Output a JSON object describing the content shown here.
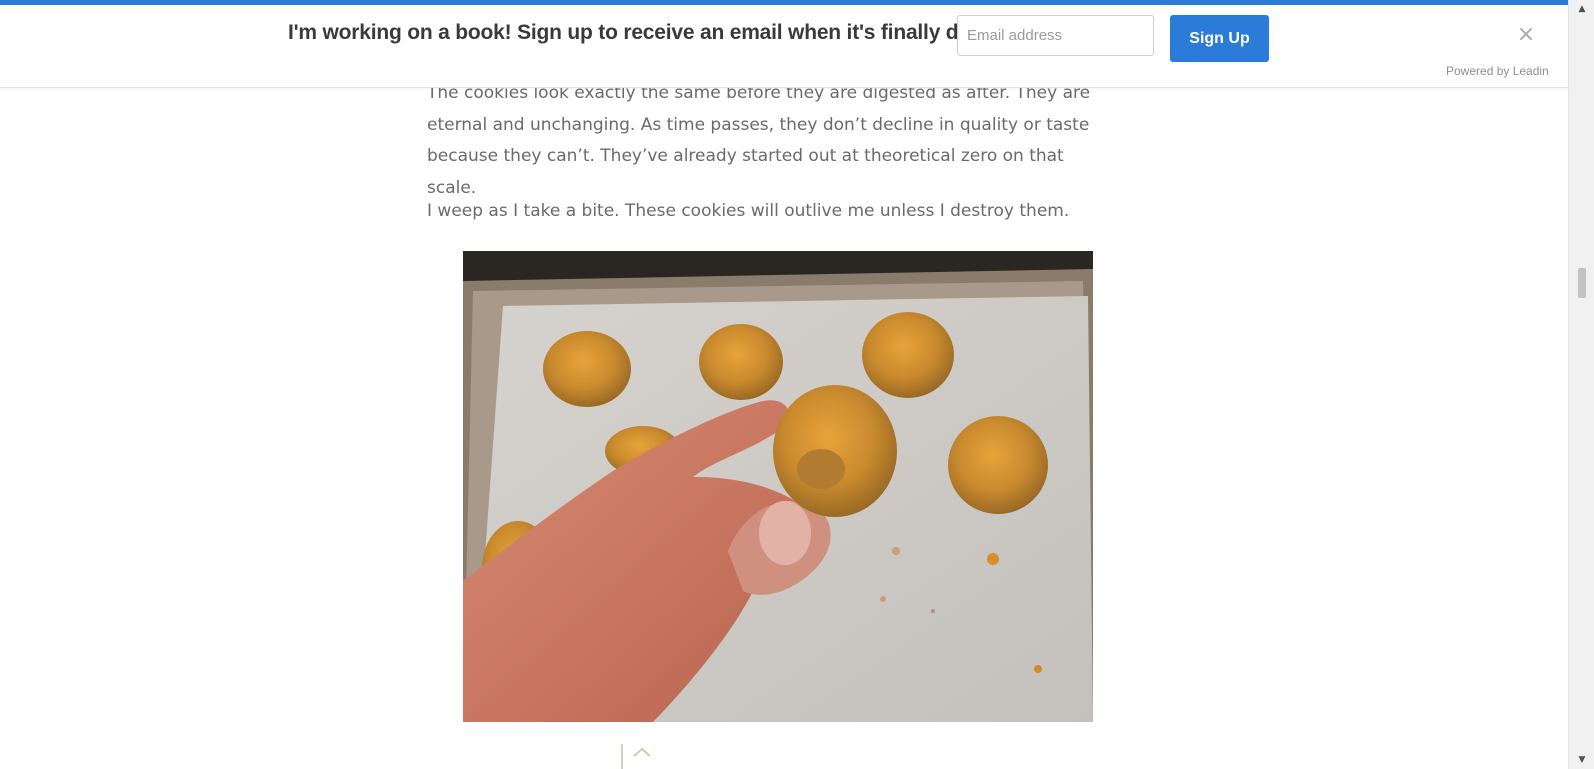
{
  "banner": {
    "message": "I'm working on a book! Sign up to receive an email when it's finally done.",
    "email_placeholder": "Email address",
    "signup_label": "Sign Up",
    "close_glyph": "×",
    "powered_by": "Powered by Leadin",
    "accent_color": "#2b7bd8"
  },
  "article": {
    "paragraphs": [
      "The cookies look exactly the same before they are digested as after. They are eternal and unchanging. As time passes, they don’t decline in quality or taste because they can’t. They’ve already started out at theoretical zero on that scale.",
      "I weep as I take a bite. These cookies will outlive me unless I destroy them."
    ],
    "text_color": "#6a6a6a"
  },
  "scrollbar": {
    "up_glyph": "▲",
    "down_glyph": "▼"
  }
}
